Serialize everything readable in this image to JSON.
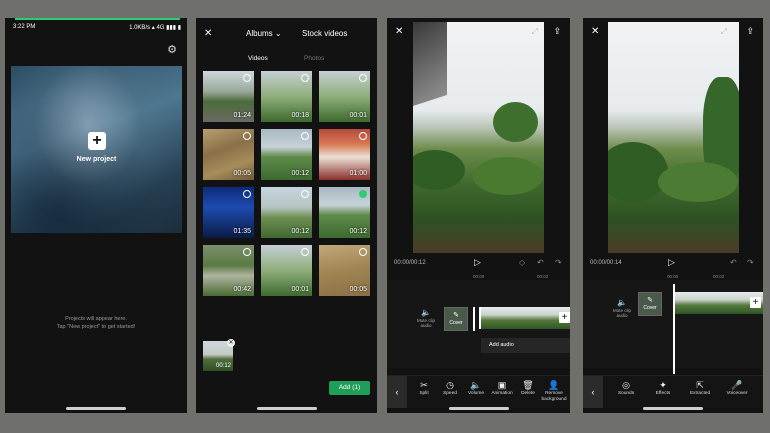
{
  "home": {
    "status_time": "3:22 PM",
    "status_right": "1.0KB/s ▴ 4G ▮▮▮ ▮",
    "new_project_label": "New project",
    "empty_line1": "Projects will appear here.",
    "empty_line2": "Tap \"New project\" to get started!"
  },
  "picker": {
    "albums_label": "Albums ⌄",
    "stock_label": "Stock videos",
    "tab_videos": "Videos",
    "tab_photos": "Photos",
    "thumbs": [
      {
        "duration": "01:24",
        "style": "g-road",
        "selected": false
      },
      {
        "duration": "00:18",
        "style": "g-sign",
        "selected": false
      },
      {
        "duration": "00:01",
        "style": "g-sign",
        "selected": false
      },
      {
        "duration": "00:05",
        "style": "g-soil",
        "selected": false
      },
      {
        "duration": "00:12",
        "style": "g-green",
        "selected": false
      },
      {
        "duration": "01:00",
        "style": "g-news",
        "selected": false
      },
      {
        "duration": "01:35",
        "style": "g-head",
        "selected": false
      },
      {
        "duration": "00:12",
        "style": "g-field",
        "selected": false
      },
      {
        "duration": "00:12",
        "style": "g-green",
        "selected": true
      },
      {
        "duration": "00:42",
        "style": "g-bush",
        "selected": false
      },
      {
        "duration": "00:01",
        "style": "g-sign",
        "selected": false
      },
      {
        "duration": "00:05",
        "style": "g-soil2",
        "selected": false
      }
    ],
    "picked_duration": "00:12",
    "add_label": "Add (1)"
  },
  "editor1": {
    "time": "00:00/00:12",
    "ruler_a": "00:00",
    "ruler_b": "00:02",
    "mute_label": "Mute clip audio",
    "cover_label": "Cover",
    "add_audio": "Add audio",
    "tools": [
      {
        "icon": "✂",
        "label": "Split",
        "name": "tool-split"
      },
      {
        "icon": "◷",
        "label": "Speed",
        "name": "tool-speed"
      },
      {
        "icon": "🔈",
        "label": "Volume",
        "name": "tool-volume"
      },
      {
        "icon": "▣",
        "label": "Animation",
        "name": "tool-animation"
      },
      {
        "icon": "🗑",
        "label": "Delete",
        "name": "tool-delete"
      },
      {
        "icon": "👤",
        "label": "Remove background",
        "name": "tool-remove-background"
      }
    ]
  },
  "editor2": {
    "time": "00:00/00:14",
    "ruler_a": "00:00",
    "ruler_b": "00:02",
    "mute_label": "Mute clip audio",
    "cover_label": "Cover",
    "tools": [
      {
        "icon": "◎",
        "label": "Sounds",
        "name": "tool-sounds"
      },
      {
        "icon": "✦",
        "label": "Effects",
        "name": "tool-effects"
      },
      {
        "icon": "⇱",
        "label": "Extracted",
        "name": "tool-extracted"
      },
      {
        "icon": "🎤",
        "label": "Voiceover",
        "name": "tool-voiceover"
      }
    ]
  }
}
